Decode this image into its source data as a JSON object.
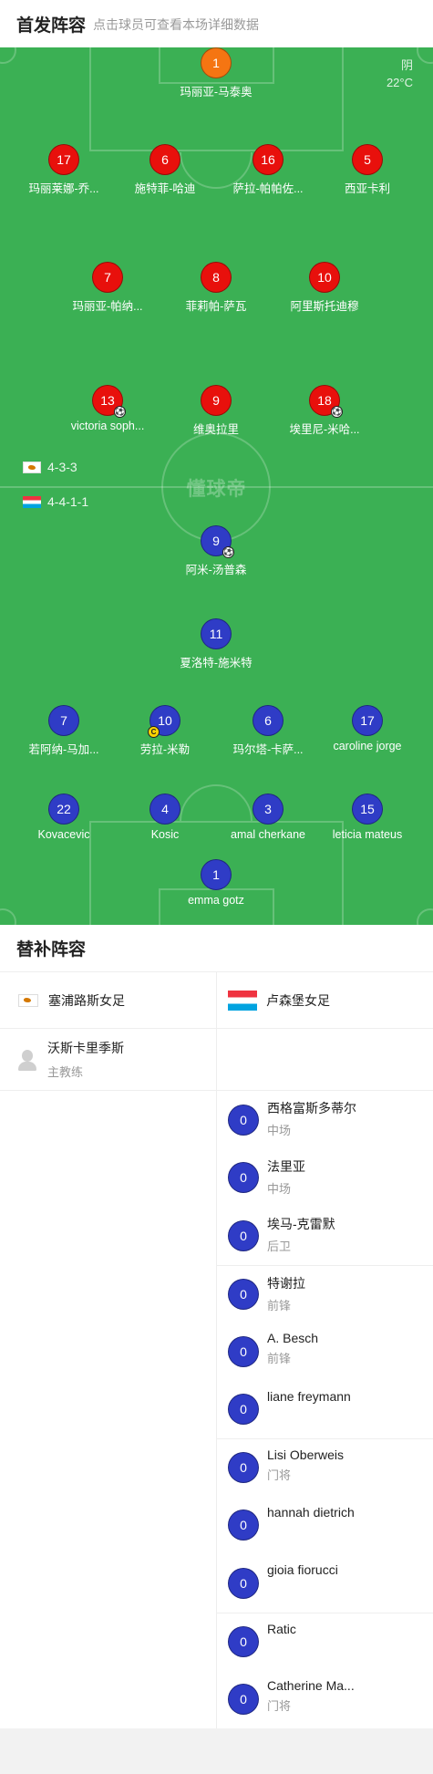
{
  "header": {
    "title": "首发阵容",
    "subtitle": "点击球员可查看本场详细数据"
  },
  "weather": {
    "condition": "阴",
    "temperature": "22°C"
  },
  "watermark": "懂球帝",
  "formations": {
    "home": "4-3-3",
    "away": "4-4-1-1"
  },
  "home_lineup": [
    {
      "number": "1",
      "name": "玛丽亚-马泰奥",
      "goalkeeper": true
    },
    {
      "number": "17",
      "name": "玛丽莱娜-乔..."
    },
    {
      "number": "6",
      "name": "施特菲-哈迪"
    },
    {
      "number": "16",
      "name": "萨拉-帕帕佐..."
    },
    {
      "number": "5",
      "name": "西亚卡利"
    },
    {
      "number": "7",
      "name": "玛丽亚-帕纳..."
    },
    {
      "number": "8",
      "name": "菲莉帕-萨瓦"
    },
    {
      "number": "10",
      "name": "阿里斯托迪穆"
    },
    {
      "number": "13",
      "name": "victoria soph...",
      "goal": true
    },
    {
      "number": "9",
      "name": "维奥拉里"
    },
    {
      "number": "18",
      "name": "埃里尼-米哈...",
      "goal": true
    }
  ],
  "away_lineup": [
    {
      "number": "9",
      "name": "阿米-汤普森",
      "goal": true
    },
    {
      "number": "11",
      "name": "夏洛特-施米特"
    },
    {
      "number": "7",
      "name": "若阿纳-马加..."
    },
    {
      "number": "10",
      "name": "劳拉-米勒",
      "captain": true
    },
    {
      "number": "6",
      "name": "玛尔塔-卡萨..."
    },
    {
      "number": "17",
      "name": "caroline jorge"
    },
    {
      "number": "22",
      "name": "Kovacevic"
    },
    {
      "number": "4",
      "name": "Kosic"
    },
    {
      "number": "3",
      "name": "amal cherkane"
    },
    {
      "number": "15",
      "name": "leticia mateus"
    },
    {
      "number": "1",
      "name": "emma gotz"
    }
  ],
  "captain_mark": "C",
  "goal_mark": "⚽",
  "subs": {
    "title": "替补阵容",
    "home_team": "塞浦路斯女足",
    "away_team": "卢森堡女足",
    "home_coach": {
      "name": "沃斯卡里季斯",
      "role": "主教练"
    },
    "away_players": [
      {
        "number": "0",
        "name": "西格富斯多蒂尔",
        "position": "中场"
      },
      {
        "number": "0",
        "name": "法里亚",
        "position": "中场"
      },
      {
        "number": "0",
        "name": "埃马-克雷默",
        "position": "后卫"
      },
      {
        "number": "0",
        "name": "特谢拉",
        "position": "前锋"
      },
      {
        "number": "0",
        "name": "A. Besch",
        "position": "前锋"
      },
      {
        "number": "0",
        "name": "liane freymann",
        "position": ""
      },
      {
        "number": "0",
        "name": "Lisi Oberweis",
        "position": "门将"
      },
      {
        "number": "0",
        "name": "hannah dietrich",
        "position": ""
      },
      {
        "number": "0",
        "name": "gioia fiorucci",
        "position": ""
      },
      {
        "number": "0",
        "name": "Ratic",
        "position": ""
      },
      {
        "number": "0",
        "name": "Catherine Ma...",
        "position": "门将"
      }
    ]
  },
  "colors": {
    "pitch": "#3bb054",
    "home": "#e8100c",
    "home_gk": "#f57512",
    "away": "#2f3cc6"
  }
}
